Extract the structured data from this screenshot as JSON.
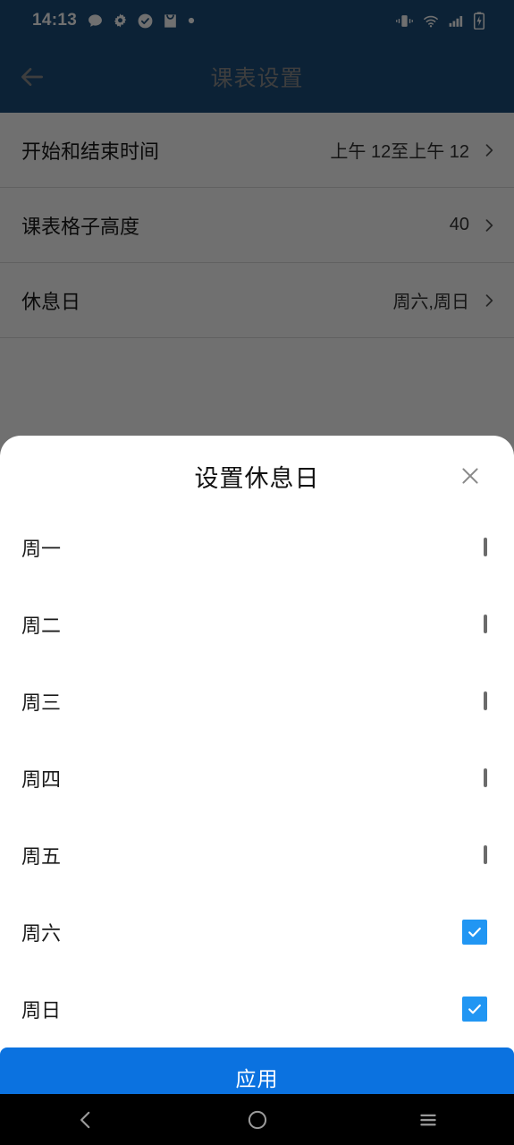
{
  "statusbar": {
    "time": "14:13",
    "left_icons": [
      "chat-bubble-icon",
      "gear-icon",
      "check-circle-icon",
      "inbox-icon",
      "dot-icon"
    ],
    "right_icons": [
      "vibrate-icon",
      "wifi-icon",
      "signal-bars-icon",
      "battery-charging-icon"
    ]
  },
  "appbar": {
    "back_icon": "arrow-left-icon",
    "title": "课表设置"
  },
  "settings": {
    "rows": [
      {
        "label": "开始和结束时间",
        "value": "上午 12至上午 12",
        "chevron": "chevron-right-icon"
      },
      {
        "label": "课表格子高度",
        "value": "40",
        "chevron": "chevron-right-icon"
      },
      {
        "label": "休息日",
        "value": "周六,周日",
        "chevron": "chevron-right-icon"
      }
    ]
  },
  "dialog": {
    "title": "设置休息日",
    "close_icon": "close-icon",
    "days": [
      {
        "label": "周一",
        "checked": false
      },
      {
        "label": "周二",
        "checked": false
      },
      {
        "label": "周三",
        "checked": false
      },
      {
        "label": "周四",
        "checked": false
      },
      {
        "label": "周五",
        "checked": false
      },
      {
        "label": "周六",
        "checked": true
      },
      {
        "label": "周日",
        "checked": true
      }
    ],
    "apply_label": "应用"
  },
  "navbar": {
    "back": "nav-back-icon",
    "home": "nav-home-icon",
    "recents": "nav-recents-icon"
  },
  "colors": {
    "appbar": "#1c4e7c",
    "accent": "#2196f3",
    "apply": "#0b72e0",
    "scrim": "rgba(0,0,0,0.56)"
  }
}
